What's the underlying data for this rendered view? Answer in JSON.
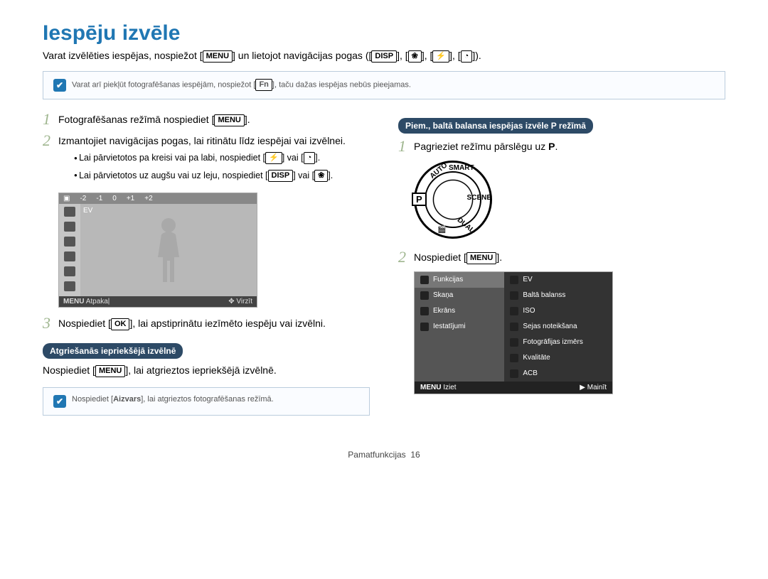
{
  "title": "Iespēju izvēle",
  "intro_a": "Varat izvēlēties iespējas, nospiežot [",
  "intro_b": "] un lietojot navigācijas pogas ([",
  "intro_c": "], [",
  "intro_d": "], [",
  "intro_e": "], [",
  "intro_f": "]).",
  "key_menu": "MENU",
  "key_disp": "DISP",
  "key_ok": "OK",
  "key_fn": "Fn",
  "note1_a": "Varat arī piekļūt fotografēšanas iespējām, nospiežot [",
  "note1_b": "], taču dažas iespējas nebūs pieejamas.",
  "left": {
    "s1_a": "Fotografēšanas režīmā nospiediet [",
    "s1_b": "].",
    "s2": "Izmantojiet navigācijas pogas, lai ritinātu līdz iespējai vai izvēlnei.",
    "s2b1_a": "Lai pārvietotos pa kreisi vai pa labi, nospiediet [",
    "s2b1_b": "] vai [",
    "s2b1_c": "].",
    "s2b2_a": "Lai pārvietotos uz augšu vai uz leju, nospiediet [",
    "s2b2_b": "] vai [",
    "s2b2_c": "].",
    "ev_scale": [
      "-2",
      "-1",
      "0",
      "+1",
      "+2"
    ],
    "ev_label": "EV",
    "ev_back": "Atpakaļ",
    "ev_move": "Virzīt",
    "s3_a": "Nospiediet [",
    "s3_b": "], lai apstiprinātu iezīmēto iespēju vai izvēlni.",
    "badge_back": "Atgriešanās iepriekšējā izvēlnē",
    "back_a": "Nospiediet [",
    "back_b": "], lai atgrieztos iepriekšējā izvēlnē.",
    "note2_a": "Nospiediet [",
    "note2_key": "Aizvars",
    "note2_b": "], lai atgrieztos fotografēšanas režīmā."
  },
  "right": {
    "badge_example": "Piem., baltā balansa iespējas izvēle P režīmā",
    "s1_a": "Pagrieziet režīmu pārslēgu uz ",
    "s1_b": ".",
    "s2_a": "Nospiediet [",
    "s2_b": "].",
    "menu_left": [
      "Funkcijas",
      "Skaņa",
      "Ekrāns",
      "Iestatījumi"
    ],
    "menu_right": [
      "EV",
      "Baltā balanss",
      "ISO",
      "Sejas noteikšana",
      "Fotogrāfijas izmērs",
      "Kvalitāte",
      "ACB"
    ],
    "menu_exit": "Iziet",
    "menu_change": "Mainīt"
  },
  "footer_section": "Pamatfunkcijas",
  "footer_page": "16",
  "glyph_flower": "❀",
  "glyph_flash": "⚡",
  "glyph_timer": "◔",
  "glyph_move": "✥",
  "glyph_tri": "▶",
  "mode_p": "P"
}
